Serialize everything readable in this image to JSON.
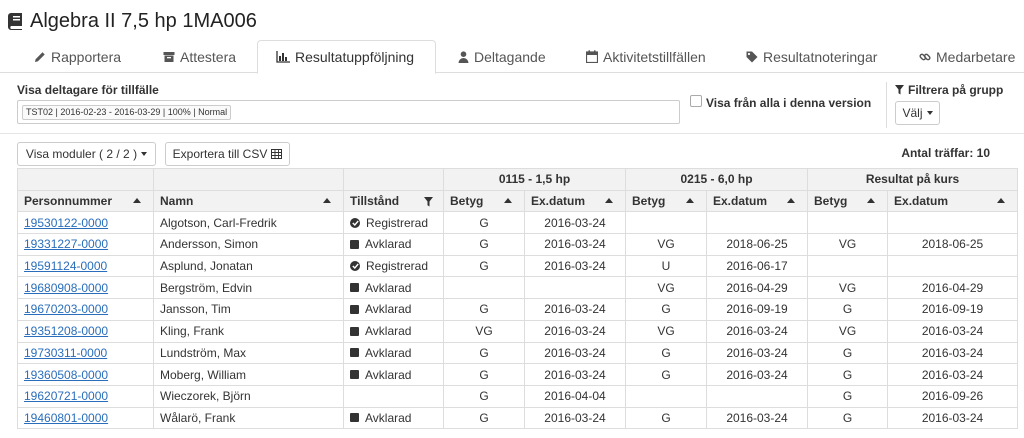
{
  "course": {
    "title": "Algebra II 7,5 hp 1MA006",
    "icon": "book-icon"
  },
  "tabs": [
    {
      "label": "Rapportera",
      "icon": "pencil-icon",
      "active": false
    },
    {
      "label": "Attestera",
      "icon": "archive-icon",
      "active": false
    },
    {
      "label": "Resultatuppföljning",
      "icon": "bar-chart-icon",
      "active": true
    },
    {
      "label": "Deltagande",
      "icon": "user-icon",
      "active": false
    },
    {
      "label": "Aktivitetstillfällen",
      "icon": "calendar-icon",
      "active": false
    },
    {
      "label": "Resultatnoteringar",
      "icon": "tag-icon",
      "active": false
    },
    {
      "label": "Medarbetare",
      "icon": "link-icon",
      "active": false
    }
  ],
  "filters": {
    "occasion_label": "Visa deltagare för tillfälle",
    "occasion_tag": "TST02 | 2016-02-23 - 2016-03-29 | 100% | Normal",
    "all_versions_label": "Visa från alla i denna version",
    "all_versions_checked": false,
    "group_label": "Filtrera på grupp",
    "group_select": "Välj"
  },
  "toolbar": {
    "modules_button": "Visa moduler ( 2 / 2 )",
    "export_button": "Exportera till CSV",
    "hits_label": "Antal träffar: 10"
  },
  "table": {
    "groups": [
      "0115 - 1,5 hp",
      "0215 - 6,0 hp",
      "Resultat på kurs"
    ],
    "columns": [
      "Personnummer",
      "Namn",
      "Tillstånd",
      "Betyg",
      "Ex.datum",
      "Betyg",
      "Ex.datum",
      "Betyg",
      "Ex.datum"
    ],
    "rows": [
      {
        "pnr": "19530122-0000",
        "name": "Algotson, Carl-Fredrik",
        "state": "Registrerad",
        "state_icon": "check-circle-icon",
        "g1": "G",
        "d1": "2016-03-24",
        "g2": "",
        "d2": "",
        "g3": "",
        "d3": ""
      },
      {
        "pnr": "19331227-0000",
        "name": "Andersson, Simon",
        "state": "Avklarad",
        "state_icon": "square-icon",
        "g1": "G",
        "d1": "2016-03-24",
        "g2": "VG",
        "d2": "2018-06-25",
        "g3": "VG",
        "d3": "2018-06-25"
      },
      {
        "pnr": "19591124-0000",
        "name": "Asplund, Jonatan",
        "state": "Registrerad",
        "state_icon": "check-circle-icon",
        "g1": "G",
        "d1": "2016-03-24",
        "g2": "U",
        "d2": "2016-06-17",
        "g3": "",
        "d3": ""
      },
      {
        "pnr": "19680908-0000",
        "name": "Bergström, Edvin",
        "state": "Avklarad",
        "state_icon": "square-icon",
        "g1": "",
        "d1": "",
        "g2": "VG",
        "d2": "2016-04-29",
        "g3": "VG",
        "d3": "2016-04-29"
      },
      {
        "pnr": "19670203-0000",
        "name": "Jansson, Tim",
        "state": "Avklarad",
        "state_icon": "square-icon",
        "g1": "G",
        "d1": "2016-03-24",
        "g2": "G",
        "d2": "2016-09-19",
        "g3": "G",
        "d3": "2016-09-19"
      },
      {
        "pnr": "19351208-0000",
        "name": "Kling, Frank",
        "state": "Avklarad",
        "state_icon": "square-icon",
        "g1": "VG",
        "d1": "2016-03-24",
        "g2": "VG",
        "d2": "2016-03-24",
        "g3": "VG",
        "d3": "2016-03-24"
      },
      {
        "pnr": "19730311-0000",
        "name": "Lundström, Max",
        "state": "Avklarad",
        "state_icon": "square-icon",
        "g1": "G",
        "d1": "2016-03-24",
        "g2": "G",
        "d2": "2016-03-24",
        "g3": "G",
        "d3": "2016-03-24"
      },
      {
        "pnr": "19360508-0000",
        "name": "Moberg, William",
        "state": "Avklarad",
        "state_icon": "square-icon",
        "g1": "G",
        "d1": "2016-03-24",
        "g2": "G",
        "d2": "2016-03-24",
        "g3": "G",
        "d3": "2016-03-24"
      },
      {
        "pnr": "19620721-0000",
        "name": "Wieczorek, Björn",
        "state": "",
        "state_icon": "",
        "g1": "G",
        "d1": "2016-04-04",
        "g2": "",
        "d2": "",
        "g3": "G",
        "d3": "2016-09-26"
      },
      {
        "pnr": "19460801-0000",
        "name": "Wålarö, Frank",
        "state": "Avklarad",
        "state_icon": "square-icon",
        "g1": "G",
        "d1": "2016-03-24",
        "g2": "G",
        "d2": "2016-03-24",
        "g3": "G",
        "d3": "2016-03-24"
      }
    ]
  },
  "colors": {
    "link": "#2a6ebb",
    "header_bg": "#f2f2f2",
    "border": "#dddddd"
  }
}
